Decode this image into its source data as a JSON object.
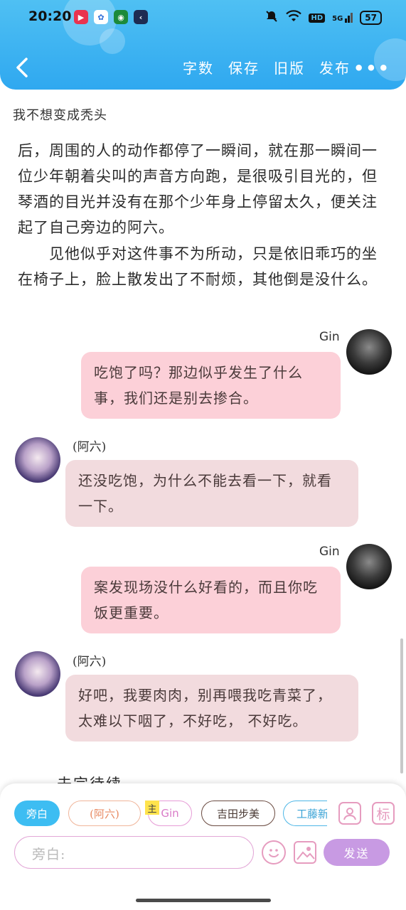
{
  "status_bar": {
    "time": "20:20",
    "network_label": "HD",
    "signal_label": "5G",
    "battery": "57"
  },
  "header": {
    "back_icon": "chevron-left-icon",
    "toolbar": [
      "字数",
      "保存",
      "旧版",
      "发布"
    ],
    "more_icon": "more-dots-icon",
    "background": "#3fb5f2"
  },
  "document": {
    "title": "我不想变成秃头",
    "paragraphs": [
      "后，周围的人的动作都停了一瞬间，就在那一瞬间一位少年朝着尖叫的声音方向跑，是很吸引目光的，但琴酒的目光并没有在那个少年身上停留太久，便关注起了自己旁边的阿六。",
      "　　见他似乎对这件事不为所动，只是依旧乖巧的坐在椅子上，脸上散发出了不耐烦，其他倒是没什么。"
    ],
    "cut_text": "未完待续"
  },
  "messages": [
    {
      "speaker": "Gin",
      "text": "吃饱了吗？那边似乎发生了什么事，我们还是别去掺合。"
    },
    {
      "speaker": "(阿六)",
      "text": "还没吃饱，为什么不能去看一下，就看一下。"
    },
    {
      "speaker": "Gin",
      "text": "案发现场没什么好看的，而且你吃饭更重要。"
    },
    {
      "speaker": "(阿六)",
      "text": "好吧，我要肉肉，别再喂我吃青菜了，太难以下咽了，不好吃， 不好吃。"
    }
  ],
  "roles": {
    "narrator": "旁白",
    "ali": "(阿六)",
    "gin": "Gin",
    "main_tag": "主",
    "yoshida": "吉田步美",
    "kudo": "工藤新",
    "mark_label": "标"
  },
  "composer": {
    "input_text": "旁白:",
    "send_label": "发送"
  },
  "colors": {
    "accent_blue": "#3dbdf2",
    "gin_bubble": "#fcd0d8",
    "ali_bubble": "#f2dbde",
    "send_button": "#c89ae3"
  }
}
